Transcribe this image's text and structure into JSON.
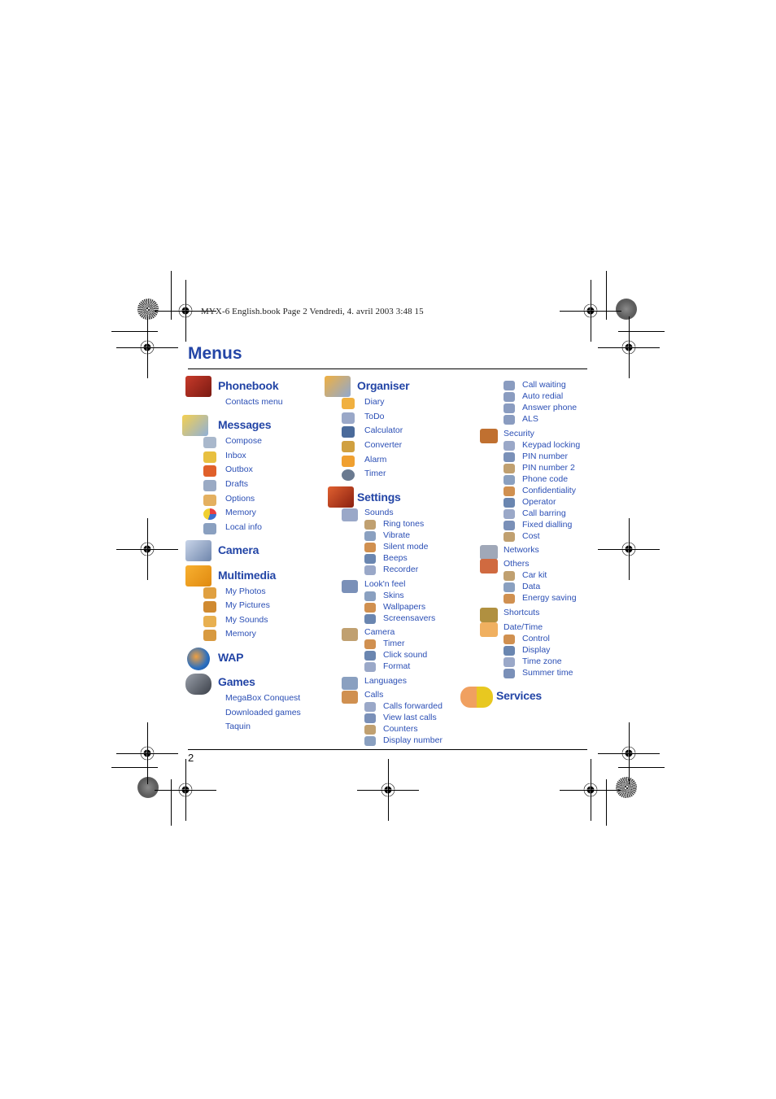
{
  "print_header": "MYX-6 English.book  Page 2  Vendredi, 4. avril 2003  3:48 15",
  "page_title": "Menus",
  "page_number": "2",
  "colors": {
    "heading": "#2345a6",
    "item": "#2b4fb5",
    "rule": "#000000"
  },
  "columns": [
    {
      "sections": [
        {
          "title": "Phonebook",
          "icon": "phonebook-icon",
          "items": [
            {
              "label": "Contacts menu"
            }
          ]
        },
        {
          "title": "Messages",
          "icon": "messages-icon",
          "items": [
            {
              "label": "Compose",
              "icon": "compose-icon"
            },
            {
              "label": "Inbox",
              "icon": "inbox-icon"
            },
            {
              "label": "Outbox",
              "icon": "outbox-icon"
            },
            {
              "label": "Drafts",
              "icon": "drafts-icon"
            },
            {
              "label": "Options",
              "icon": "options-icon"
            },
            {
              "label": "Memory",
              "icon": "memory-pie-icon"
            },
            {
              "label": "Local info",
              "icon": "local-info-icon"
            }
          ]
        },
        {
          "title": "Camera",
          "icon": "camera-icon",
          "items": []
        },
        {
          "title": "Multimedia",
          "icon": "folder-icon",
          "items": [
            {
              "label": "My Photos",
              "icon": "photos-icon"
            },
            {
              "label": "My Pictures",
              "icon": "pictures-icon"
            },
            {
              "label": "My Sounds",
              "icon": "sounds-icon"
            },
            {
              "label": "Memory",
              "icon": "memory-icon"
            }
          ]
        },
        {
          "title": "WAP",
          "icon": "globe-icon",
          "items": []
        },
        {
          "title": "Games",
          "icon": "gamepad-icon",
          "items": [
            {
              "label": "MegaBox Conquest"
            },
            {
              "label": "Downloaded games"
            },
            {
              "label": "Taquin"
            }
          ]
        }
      ]
    },
    {
      "sections": [
        {
          "title": "Organiser",
          "icon": "organiser-icon",
          "items": [
            {
              "label": "Diary",
              "icon": "diary-icon"
            },
            {
              "label": "ToDo",
              "icon": "todo-icon"
            },
            {
              "label": "Calculator",
              "icon": "calculator-icon"
            },
            {
              "label": "Converter",
              "icon": "converter-icon"
            },
            {
              "label": "Alarm",
              "icon": "alarm-icon"
            },
            {
              "label": "Timer",
              "icon": "timer-icon"
            }
          ]
        },
        {
          "title": "Settings",
          "icon": "toolbox-icon",
          "groups": [
            {
              "label": "Sounds",
              "icon": "speaker-icon",
              "items": [
                "Ring tones",
                "Vibrate",
                "Silent mode",
                "Beeps",
                "Recorder"
              ]
            },
            {
              "label": "Look'n feel",
              "icon": "laptop-icon",
              "items": [
                "Skins",
                "Wallpapers",
                "Screensavers"
              ]
            },
            {
              "label": "Camera",
              "icon": "camera-small-icon",
              "items": [
                "Timer",
                "Click sound",
                "Format"
              ]
            },
            {
              "label": "Languages",
              "icon": "languages-icon",
              "items": []
            },
            {
              "label": "Calls",
              "icon": "calls-icon",
              "items": [
                "Calls forwarded",
                "View last calls",
                "Counters",
                "Display number"
              ]
            }
          ]
        }
      ]
    },
    {
      "continued_items": [
        "Call waiting",
        "Auto redial",
        "Answer phone",
        "ALS"
      ],
      "groups": [
        {
          "label": "Security",
          "icon": "briefcase-icon",
          "items": [
            "Keypad locking",
            "PIN number",
            "PIN number 2",
            "Phone code",
            "Confidentiality",
            "Operator",
            "Call barring",
            "Fixed dialling",
            "Cost"
          ]
        },
        {
          "label": "Networks",
          "icon": "networks-icon",
          "items": []
        },
        {
          "label": "Others",
          "icon": "others-icon",
          "items": [
            "Car kit",
            "Data",
            "Energy saving"
          ]
        },
        {
          "label": "Shortcuts",
          "icon": "shortcuts-icon",
          "items": []
        },
        {
          "label": "Date/Time",
          "icon": "clock-icon",
          "items": [
            "Control",
            "Display",
            "Time zone",
            "Summer time"
          ]
        }
      ],
      "services": {
        "title": "Services",
        "icon": "services-bell-icon"
      }
    }
  ]
}
